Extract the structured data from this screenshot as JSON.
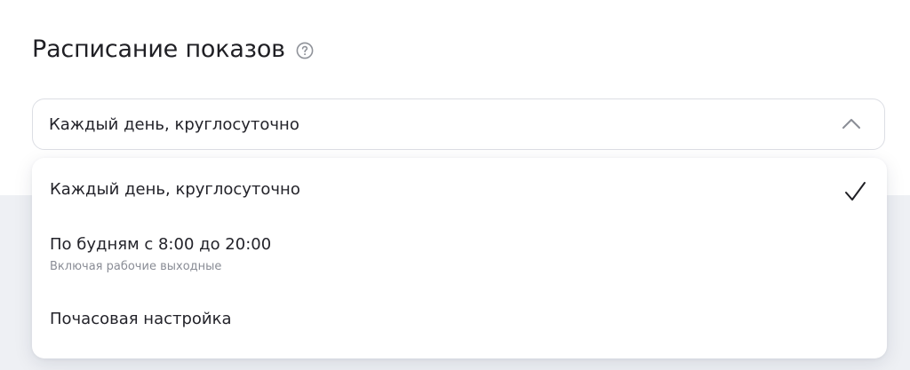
{
  "section": {
    "title": "Расписание показов",
    "help_icon": "question-circle-icon"
  },
  "select": {
    "value": "Каждый день, круглосуточно",
    "state": "expanded",
    "chevron_icon": "chevron-up-icon"
  },
  "menu": {
    "selected_index": 0,
    "check_icon": "check-icon",
    "items": [
      {
        "label": "Каждый день, круглосуточно",
        "sublabel": "",
        "selected": true
      },
      {
        "label": "По будням с 8:00 до 20:00",
        "sublabel": "Включая рабочие выходные",
        "selected": false
      },
      {
        "label": "Почасовая настройка",
        "sublabel": "",
        "selected": false
      }
    ]
  },
  "colors": {
    "text": "#1f1f24",
    "secondary_text": "#8a8d96",
    "border": "#dcdee4",
    "background_band": "#eef0f4",
    "surface": "#ffffff"
  }
}
